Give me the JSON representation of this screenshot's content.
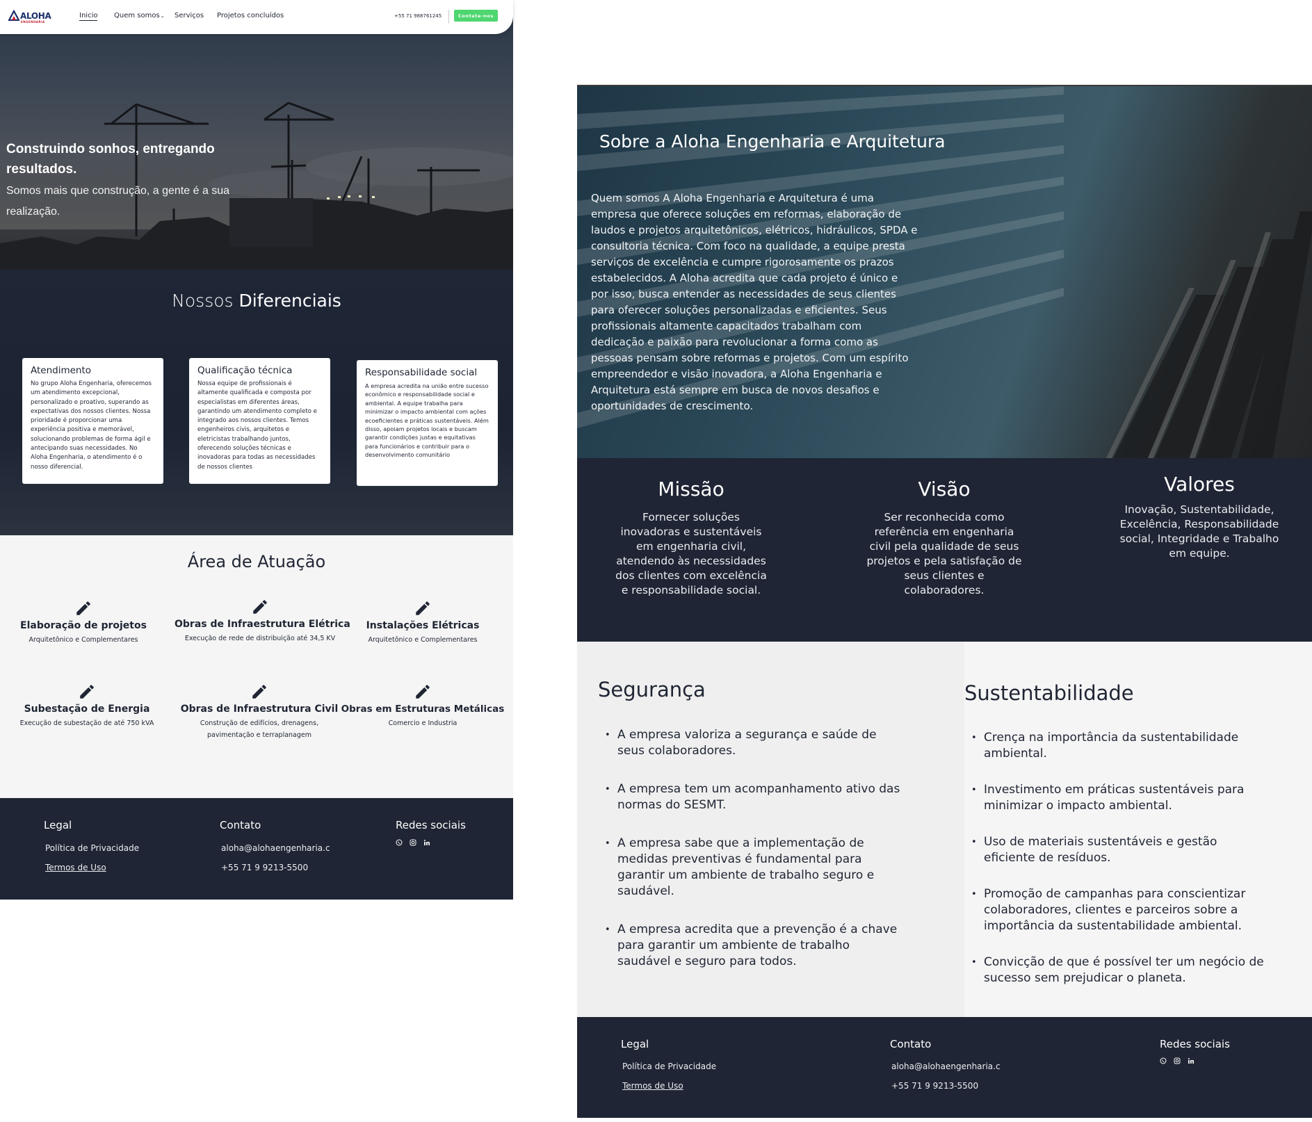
{
  "colors": {
    "navy": "#1f2534",
    "cta_green": "#4ed66f",
    "logo_blue": "#1a2e6b",
    "logo_red": "#c02030"
  },
  "nav": {
    "logo_text": "ALOHA",
    "logo_sub": "ENGENHARIA",
    "links": [
      "Inicio",
      "Quem somos",
      "Serviços",
      "Projetos concluídos"
    ],
    "phone": "+55 71 988761245",
    "cta": "Contate-nos"
  },
  "hero": {
    "title": "Construindo sonhos, entregando resultados.",
    "subtitle": "Somos mais que construção, a gente é a sua realização."
  },
  "diferenciais": {
    "title_light": "Nossos ",
    "title_bold": "Diferenciais",
    "cards": [
      {
        "title": "Atendimento",
        "body": "No grupo Aloha Engenharia, oferecemos um atendimento excepcional, personalizado e proativo, superando as expectativas dos nossos clientes. Nossa prioridade é proporcionar uma experiência positiva e memorável, solucionando problemas de forma ágil e antecipando suas necessidades. No Aloha Engenharia, o atendimento é o nosso diferencial."
      },
      {
        "title": "Qualificação técnica",
        "body": "Nossa equipe de profissionais é altamente qualificada e composta por especialistas em diferentes áreas, garantindo um atendimento completo e integrado aos nossos clientes. Temos engenheiros civis, arquitetos e eletricistas trabalhando juntos, oferecendo soluções técnicas e inovadoras para todas as necessidades de nossos clientes"
      },
      {
        "title": "Responsabilidade social",
        "body": "A empresa acredita na união entre sucesso econômico e responsabilidade social e ambiental. A equipe trabalha para minimizar o impacto ambiental com ações ecoeficientes e práticas sustentáveis. Além disso, apoiam projetos locais e buscam garantir condições justas e equitativas para funcionários e contribuir para o desenvolvimento comunitário"
      }
    ]
  },
  "area": {
    "title": "Área de Atuação",
    "items": [
      {
        "name": "Elaboração de projetos",
        "desc": "Arquitetônico e Complementares"
      },
      {
        "name": "Obras de Infraestrutura Elétrica",
        "desc": "Execução de rede de distribuição até 34,5 KV"
      },
      {
        "name": "Instalações Elétricas",
        "desc": "Arquitetônico e Complementares"
      },
      {
        "name": "Subestação de Energia",
        "desc": "Execução de subestação de até 750 kVA"
      },
      {
        "name": "Obras de Infraestrutura Civil",
        "desc": "Construção de edifícios, drenagens, pavimentação e terraplanagem"
      },
      {
        "name": "Obras em Estruturas Metálicas",
        "desc": "Comercio e Industria"
      }
    ]
  },
  "footer": {
    "legal_head": "Legal",
    "contato_head": "Contato",
    "redes_head": "Redes sociais",
    "privacy": "Política de Privacidade",
    "terms": "Termos de Uso",
    "email": "aloha@alohaengenharia.com",
    "phone": "+55 71 9 9213-5500",
    "social_icons": [
      "whatsapp-icon",
      "instagram-icon",
      "linkedin-icon"
    ]
  },
  "about": {
    "title": "Sobre a Aloha Engenharia e Arquitetura",
    "text": "Quem somos A Aloha Engenharia e Arquitetura é uma empresa que oferece soluções em reformas, elaboração de laudos e projetos arquitetônicos, elétricos, hidráulicos, SPDA e consultoria técnica. Com foco na qualidade, a equipe presta serviços de excelência e cumpre rigorosamente os prazos estabelecidos. A Aloha acredita que cada projeto é único e por isso, busca entender as necessidades de seus clientes para oferecer soluções personalizadas e eficientes. Seus profissionais altamente capacitados trabalham com dedicação e paixão para revolucionar a forma como as pessoas pensam sobre reformas e projetos. Com um espírito empreendedor e visão inovadora, a Aloha Engenharia e Arquitetura está sempre em busca de novos desafios e oportunidades de crescimento."
  },
  "mvv": {
    "missao": {
      "title": "Missão",
      "text": "Fornecer soluções inovadoras e sustentáveis em engenharia civil, atendendo às necessidades dos clientes com excelência e responsabilidade social."
    },
    "visao": {
      "title": "Visão",
      "text": "Ser reconhecida como referência em engenharia civil pela qualidade de seus projetos e pela satisfação de seus clientes e colaboradores."
    },
    "valores": {
      "title": "Valores",
      "text": "Inovação, Sustentabilidade, Excelência, Responsabilidade social, Integridade e Trabalho em equipe."
    }
  },
  "seguranca": {
    "title": "Segurança",
    "items": [
      "A empresa valoriza a segurança e saúde de seus colaboradores.",
      "A empresa tem um acompanhamento ativo das normas do SESMT.",
      "A empresa sabe que a implementação de medidas preventivas é fundamental para garantir um ambiente de trabalho seguro e saudável.",
      "A empresa acredita que a prevenção é a chave para garantir um ambiente de trabalho saudável e seguro para todos."
    ]
  },
  "sustentabilidade": {
    "title": "Sustentabilidade",
    "items": [
      "Crença na importância da sustentabilidade ambiental.",
      "Investimento em práticas sustentáveis para minimizar o impacto ambiental.",
      "Uso de materiais sustentáveis e gestão eficiente de resíduos.",
      "Promoção de campanhas para conscientizar colaboradores, clientes e parceiros sobre a importância da sustentabilidade ambiental.",
      "Convicção de que é possível ter um negócio de sucesso sem prejudicar o planeta."
    ]
  }
}
